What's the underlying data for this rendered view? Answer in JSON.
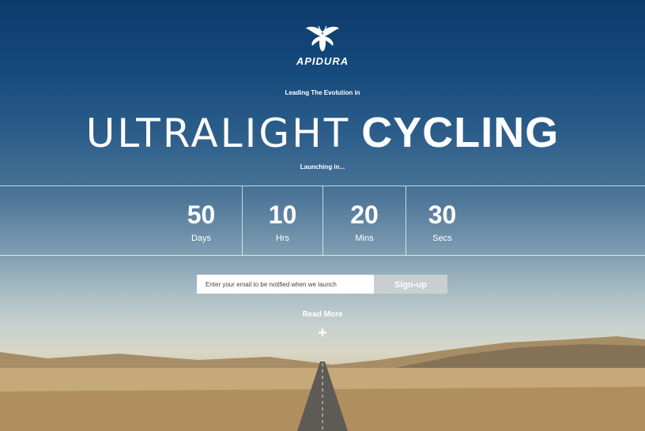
{
  "brand": {
    "name": "APIDURA",
    "logo_icon": "bee-logo-icon"
  },
  "hero": {
    "tagline": "Leading The Evolution in",
    "headline_light": "ULTRALIGHT",
    "headline_bold": "CYCLING",
    "launching": "Launching in..."
  },
  "countdown": [
    {
      "value": "50",
      "unit": "Days"
    },
    {
      "value": "10",
      "unit": "Hrs"
    },
    {
      "value": "20",
      "unit": "Mins"
    },
    {
      "value": "30",
      "unit": "Secs"
    }
  ],
  "signup": {
    "placeholder": "Enter your email to be notified when we launch",
    "button_label": "Sign-up"
  },
  "read_more": {
    "label": "Read More",
    "icon": "plus-icon",
    "glyph": "+"
  },
  "colors": {
    "sky_top": "#0b3a6b",
    "desert": "#b89c6e",
    "button_bg": "#d7d7d4"
  }
}
